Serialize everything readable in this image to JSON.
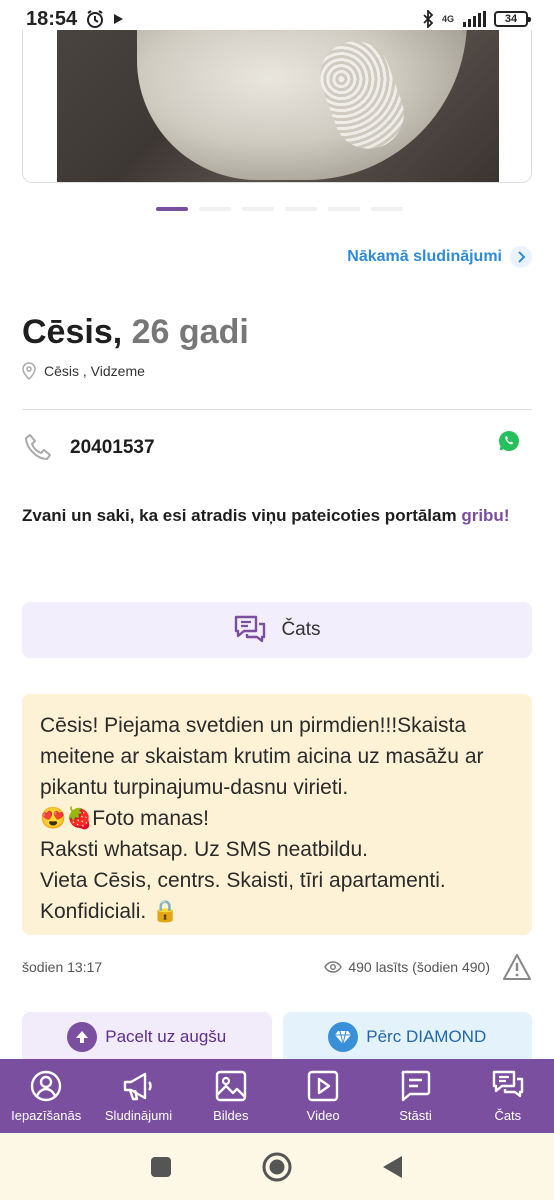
{
  "status_bar": {
    "time": "18:54",
    "network": "4G",
    "battery": "34",
    "icons": [
      "alarm-icon",
      "play-icon",
      "bluetooth-icon",
      "signal-icon",
      "battery-icon"
    ]
  },
  "gallery": {
    "dot_count": 6,
    "active_index": 0
  },
  "next_link": {
    "label": "Nākamā sludinājumi"
  },
  "listing": {
    "name": "Cēsis,",
    "age": "26 gadi",
    "location": "Cēsis ,  Vidzeme",
    "phone": "20401537",
    "call_text": "Zvani un saki, ka esi atradis viņu pateicoties portālam ",
    "call_brand": "gribu!",
    "chat_label": "Čats",
    "description": "Cēsis! Piejama svetdien un pirmdien!!!Skaista meitene ar skaistam krutim aicina uz masāžu ar pikantu turpinajumu-dasnu virieti.\n😍🍓Foto manas!\nRaksti whatsap. Uz SMS neatbildu.\nVieta Cēsis, centrs. Skaisti, tīri apartamenti.\nKonfidiciali. 🔒",
    "posted": "šodien 13:17",
    "views": "490 lasīts (šodien 490)"
  },
  "promo": {
    "up_label": "Pacelt uz augšu",
    "diamond_label": "Pērc DIAMOND"
  },
  "bottom_nav": [
    {
      "label": "Iepazīšanās",
      "icon": "profile-icon"
    },
    {
      "label": "Sludinājumi",
      "icon": "megaphone-icon"
    },
    {
      "label": "Bildes",
      "icon": "image-icon"
    },
    {
      "label": "Video",
      "icon": "video-icon"
    },
    {
      "label": "Stāsti",
      "icon": "stories-icon"
    },
    {
      "label": "Čats",
      "icon": "chat-icon"
    }
  ],
  "colors": {
    "brand": "#7b4fa0",
    "link": "#2e8bd6",
    "description_bg": "#fdf2d6",
    "chat_bg": "#f3eefb",
    "whatsapp": "#25c05b"
  }
}
